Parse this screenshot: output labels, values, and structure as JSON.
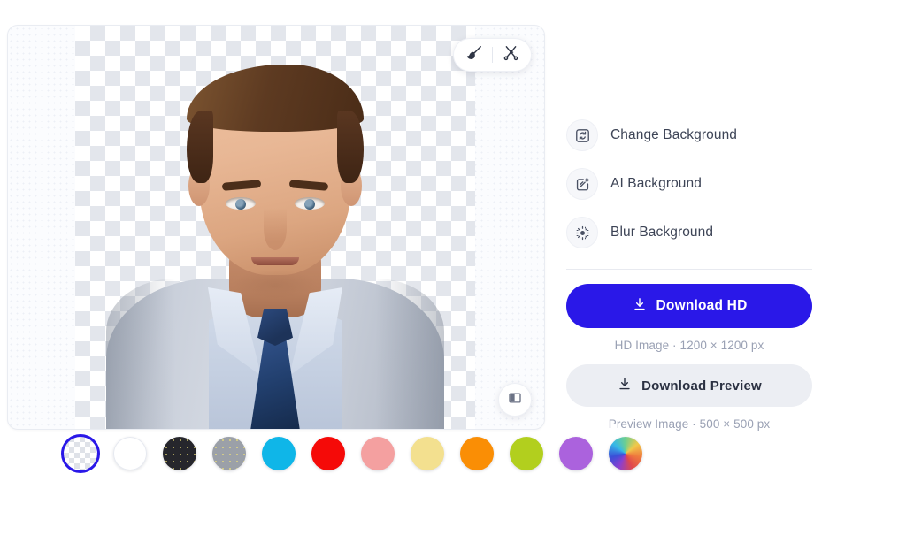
{
  "canvas": {
    "toolbar": {
      "brush_tool": "brush-tool",
      "erase_tool": "magic-erase-tool"
    },
    "compare_button": "compare-view"
  },
  "swatches": {
    "label": "background-color-swatches",
    "items": [
      {
        "name": "transparent",
        "color": "transparent",
        "selected": true
      },
      {
        "name": "white",
        "color": "#ffffff",
        "selected": false
      },
      {
        "name": "black",
        "color": "#26262c",
        "selected": false
      },
      {
        "name": "gray",
        "color": "#9ba0a8",
        "selected": false
      },
      {
        "name": "cyan",
        "color": "#0fb6e8",
        "selected": false
      },
      {
        "name": "red",
        "color": "#f50a08",
        "selected": false
      },
      {
        "name": "pink",
        "color": "#f4a0a0",
        "selected": false
      },
      {
        "name": "yellow",
        "color": "#f3e08f",
        "selected": false
      },
      {
        "name": "orange",
        "color": "#fa8e05",
        "selected": false
      },
      {
        "name": "lime",
        "color": "#b2cf1e",
        "selected": false
      },
      {
        "name": "purple",
        "color": "#ab62dd",
        "selected": false
      },
      {
        "name": "color-wheel",
        "color": "rainbow",
        "selected": false
      }
    ]
  },
  "sidebar": {
    "actions": [
      {
        "label": "Change Background",
        "icon": "change-background-icon"
      },
      {
        "label": "AI Background",
        "icon": "ai-background-icon"
      },
      {
        "label": "Blur Background",
        "icon": "blur-background-icon"
      }
    ],
    "download_hd": {
      "label": "Download HD",
      "icon": "download-icon",
      "caption": "HD Image · 1200 × 1200 px",
      "accent": "#2a18e8"
    },
    "download_preview": {
      "label": "Download Preview",
      "icon": "download-icon",
      "caption": "Preview Image · 500 × 500 px",
      "background": "#eceef3"
    }
  }
}
